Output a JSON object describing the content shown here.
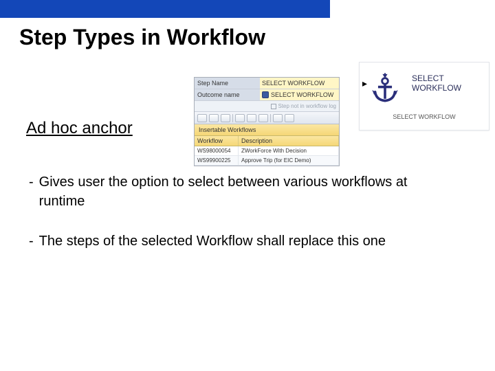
{
  "title": "Step Types in Workflow",
  "subtitle": "Ad hoc anchor",
  "bullets": [
    "Gives user the option to select between various workflows at runtime",
    "The steps of the selected Workflow shall replace this one"
  ],
  "sap": {
    "step_name_label": "Step Name",
    "step_name_value": "SELECT WORKFLOW",
    "outcome_label": "Outcome name",
    "outcome_value": "SELECT WORKFLOW",
    "step_log_text": "Step not in workflow log",
    "section_header": "Insertable Workflows",
    "col1": "Workflow",
    "col2": "Description",
    "rows": [
      {
        "id": "WS98000054",
        "desc": "ZWorkForce With Decision"
      },
      {
        "id": "WS99900225",
        "desc": "Approve Trip (for EIC Demo)"
      }
    ]
  },
  "anchor": {
    "label_line1": "SELECT",
    "label_line2": "WORKFLOW",
    "caption": "SELECT WORKFLOW"
  }
}
